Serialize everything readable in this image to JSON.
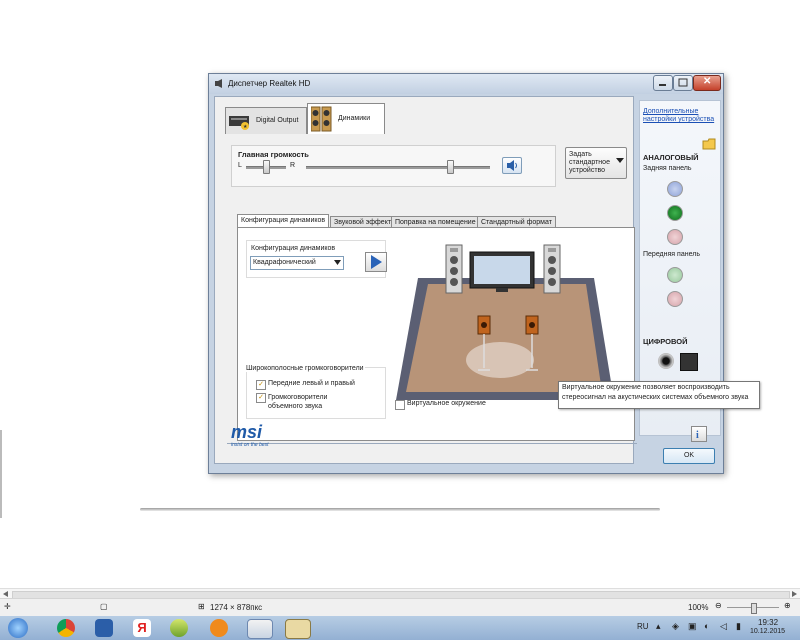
{
  "window": {
    "title": "Диспетчер Realtek HD",
    "close_glyph": "✕"
  },
  "device_tabs": [
    {
      "label": "Digital Output",
      "icon": "digital-output-icon"
    },
    {
      "label": "Динамики",
      "icon": "speakers-icon"
    }
  ],
  "volume": {
    "title": "Главная громкость",
    "left": "L",
    "right": "R",
    "balance": 0.5,
    "level": 0.78
  },
  "default_device_button": "Задать стандартное устройство",
  "inner_tabs": [
    "Конфигурация динамиков",
    "Звуковой эффект",
    "Поправка на помещение",
    "Стандартный формат"
  ],
  "config": {
    "label": "Конфигурация динамиков",
    "selected": "Квадрафонический"
  },
  "wideband": {
    "title": "Широкополосные громкоговорители",
    "options": [
      {
        "label": "Передние левый и правый",
        "checked": true
      },
      {
        "label": "Громкоговорители объемного звука",
        "checked": true
      }
    ]
  },
  "virtual_surround": {
    "label": "Виртуальное окружение",
    "checked": false
  },
  "tooltip": "Виртуальное окружение позволяет воспроизводить стереосигнал на акустических системах объемного звука",
  "side": {
    "advanced_link": "Дополнительные настройки устройства",
    "analog_title": "АНАЛОГОВЫЙ",
    "rear_panel": "Задняя панель",
    "front_panel": "Передняя панель",
    "digital_title": "ЦИФРОВОЙ"
  },
  "brand": {
    "name": "msi",
    "tagline": "insist on the best"
  },
  "ok_button": "OK",
  "viewer": {
    "dimensions": "1274 × 878пкс",
    "zoom": "100%"
  },
  "taskbar": {
    "lang": "RU",
    "time": "19:32",
    "date": "10.12.2015"
  },
  "colors": {
    "accent": "#3c7fb1",
    "msi_blue": "#1f5aa8",
    "floor": "#b89478"
  }
}
